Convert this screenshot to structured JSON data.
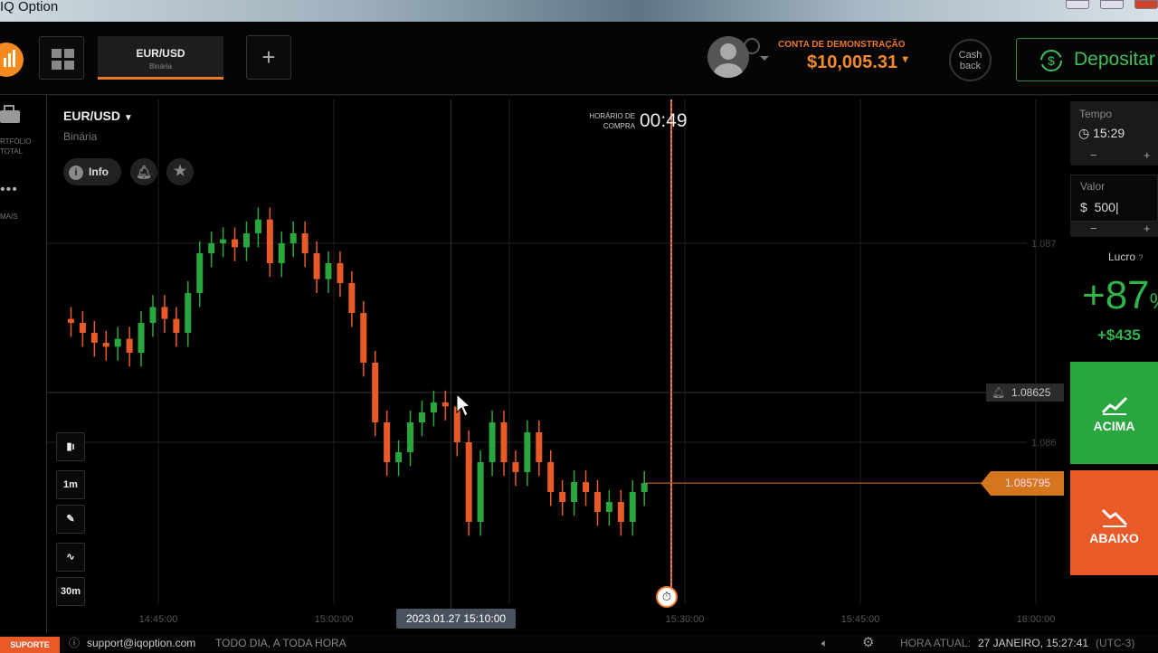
{
  "window": {
    "title": "IQ Option"
  },
  "header": {
    "tab": {
      "asset": "EUR/USD",
      "type": "Binária"
    },
    "add_tab": "+",
    "account_label": "CONTA DE DEMONSTRAÇÃO",
    "balance": "$10,005.31",
    "cashback": [
      "Cash",
      "back"
    ],
    "deposit": "Depositar"
  },
  "sidebar": {
    "items": [
      {
        "label": "RTFÓLIO",
        "label2": "TOTAL",
        "icon": "briefcase-icon"
      },
      {
        "label": "MAIS",
        "icon": "more-icon"
      }
    ]
  },
  "chart_header": {
    "asset": "EUR/USD",
    "type": "Binária",
    "info": "Info"
  },
  "purchase_timer": {
    "label1": "HORÁRIO DE",
    "label2": "COMPRA",
    "value": "00:49"
  },
  "tools": {
    "timeframe": "1m",
    "range": "30m"
  },
  "chart_data": {
    "type": "candlestick",
    "interval": "1m",
    "start_time": "14:38",
    "open_first": 1.08662,
    "closes": [
      1.0866,
      1.08655,
      1.0865,
      1.08648,
      1.08652,
      1.08645,
      1.0866,
      1.08668,
      1.08662,
      1.08655,
      1.08675,
      1.08695,
      1.087,
      1.08702,
      1.08698,
      1.08705,
      1.08712,
      1.0869,
      1.087,
      1.08705,
      1.08695,
      1.08682,
      1.0869,
      1.0868,
      1.08665,
      1.0864,
      1.0861,
      1.0859,
      1.08595,
      1.0861,
      1.08615,
      1.0862,
      1.08618,
      1.086,
      1.0856,
      1.0859,
      1.0861,
      1.0859,
      1.08585,
      1.08605,
      1.0859,
      1.08575,
      1.0857,
      1.0858,
      1.08575,
      1.08565,
      1.0857,
      1.0856,
      1.08575,
      1.085795
    ],
    "y_ticks": [
      "1.087",
      "1.086"
    ],
    "x_ticks": [
      "14:45:00",
      "15:00:00",
      "15:15:00",
      "15:30:00",
      "15:45:00",
      "16:00:00"
    ],
    "ylim": [
      1.0847,
      1.0877
    ],
    "current_price": "1.085795",
    "crosshair_price": "1.08625",
    "crosshair_time": "2023.01.27 15:10:00",
    "expiry_time": "15:30:00",
    "up_color": "#2aa63f",
    "down_color": "#e85a28"
  },
  "trade_panel": {
    "time_label": "Tempo",
    "time_value": "15:29",
    "amount_label": "Valor",
    "currency": "$",
    "amount_value": "500",
    "minus": "−",
    "plus": "+",
    "profit_label": "Lucro",
    "profit_pct": "+87",
    "pct_sign": "%",
    "profit_amount": "+$435",
    "buy_label": "ACIMA",
    "sell_label": "ABAIXO"
  },
  "footer": {
    "support": "SUPORTE",
    "email": "support@iqoption.com",
    "hours": "TODO DIA, A TODA HORA",
    "time_label": "HORA ATUAL:",
    "time_value": "27 JANEIRO, 15:27:41",
    "tz": "(UTC-3)"
  }
}
